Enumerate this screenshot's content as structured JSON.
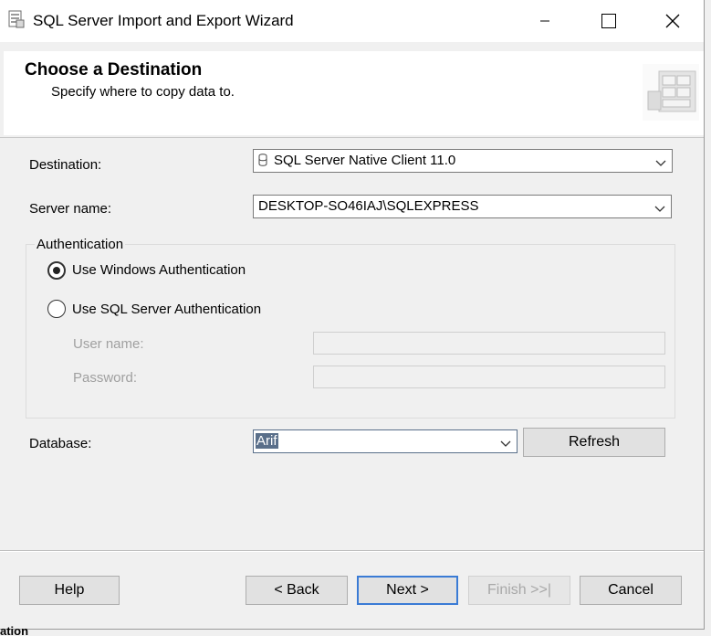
{
  "window": {
    "title": "SQL Server Import and Export Wizard"
  },
  "header": {
    "title": "Choose a Destination",
    "subtitle": "Specify where to copy data to."
  },
  "form": {
    "destination_label": "Destination:",
    "destination_value": "SQL Server Native Client 11.0",
    "server_label": "Server name:",
    "server_value": "DESKTOP-SO46IAJ\\SQLEXPRESS",
    "auth_group_label": "Authentication",
    "auth_windows_label": "Use Windows Authentication",
    "auth_sql_label": "Use SQL Server Authentication",
    "auth_selected": "windows",
    "username_label": "User name:",
    "password_label": "Password:",
    "database_label": "Database:",
    "database_value": "Arif",
    "refresh_label": "Refresh"
  },
  "footer": {
    "help_label": "Help",
    "back_label": "< Back",
    "next_label": "Next >",
    "finish_label": "Finish >>|",
    "cancel_label": "Cancel"
  },
  "background": {
    "fragment_text": "ation"
  },
  "colors": {
    "accent_border": "#3a7bd5",
    "selection": "#5a6f8a"
  },
  "icons": {
    "app": "wizard-document-icon",
    "header_graphic": "database-table-graphic"
  }
}
